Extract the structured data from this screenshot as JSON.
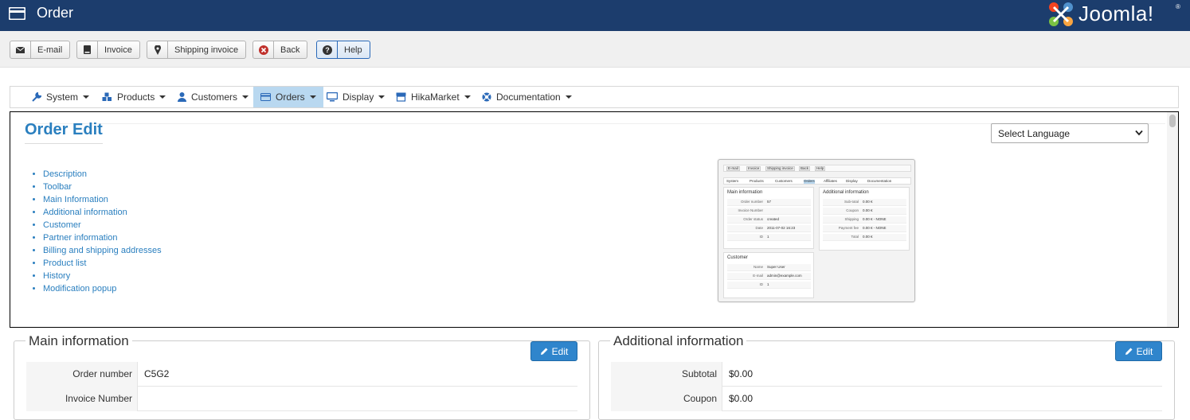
{
  "header": {
    "title": "Order",
    "title_icon": "credit-card-icon",
    "brand": "Joomla!",
    "brand_mark": "®"
  },
  "toolbar": {
    "buttons": [
      {
        "label": "E-mail",
        "icon": "envelope-icon"
      },
      {
        "label": "Invoice",
        "icon": "book-icon"
      },
      {
        "label": "Shipping invoice",
        "icon": "map-pin-icon"
      },
      {
        "label": "Back",
        "icon": "cancel-circle-icon"
      },
      {
        "label": "Help",
        "icon": "question-circle-icon"
      }
    ]
  },
  "menu": {
    "items": [
      {
        "label": "System",
        "icon": "wrench-icon"
      },
      {
        "label": "Products",
        "icon": "cubes-icon"
      },
      {
        "label": "Customers",
        "icon": "user-icon"
      },
      {
        "label": "Orders",
        "icon": "credit-card-icon",
        "active": true
      },
      {
        "label": "Display",
        "icon": "monitor-icon"
      },
      {
        "label": "HikaMarket",
        "icon": "shop-icon"
      },
      {
        "label": "Documentation",
        "icon": "lifebuoy-icon"
      }
    ]
  },
  "doc": {
    "title": "Order Edit",
    "language_select": "Select Language",
    "links": [
      "Description",
      "Toolbar",
      "Main Information",
      "Additional information",
      "Customer",
      "Partner information",
      "Billing and shipping addresses",
      "Product list",
      "History",
      "Modification popup"
    ],
    "thumbnail": {
      "toolbar": [
        "E-mail",
        "Invoice",
        "Shipping invoice",
        "Back",
        "Help"
      ],
      "menu": [
        "System",
        "Products",
        "Customers",
        "Orders",
        "Affiliates",
        "Display",
        "Documentation"
      ],
      "main_title": "Main information",
      "main_rows": [
        [
          "Order number",
          "57"
        ],
        [
          "Invoice Number",
          ""
        ],
        [
          "Order status",
          "created"
        ],
        [
          "Date",
          "2011-07-02 16:23"
        ],
        [
          "ID",
          "1"
        ]
      ],
      "additional_title": "Additional information",
      "additional_rows": [
        [
          "Sub-total",
          "0.00 €"
        ],
        [
          "Coupon",
          "0.00 €"
        ],
        [
          "Shipping",
          "0.00 € - NONE"
        ],
        [
          "Payment fee",
          "0.00 € - NONE"
        ],
        [
          "Total",
          "0.00 €"
        ]
      ],
      "customer_title": "Customer",
      "customer_rows": [
        [
          "Name",
          "Super User"
        ],
        [
          "E-mail",
          "admin@example.com"
        ],
        [
          "ID",
          "1"
        ]
      ]
    }
  },
  "main_info": {
    "legend": "Main information",
    "edit_label": "Edit",
    "rows": [
      {
        "key": "Order number",
        "value": "C5G2"
      },
      {
        "key": "Invoice Number",
        "value": ""
      }
    ]
  },
  "additional_info": {
    "legend": "Additional information",
    "edit_label": "Edit",
    "rows": [
      {
        "key": "Subtotal",
        "value": "$0.00"
      },
      {
        "key": "Coupon",
        "value": "$0.00"
      }
    ]
  },
  "colors": {
    "header_bg": "#1c3d6d",
    "accent": "#2a7fbf",
    "edit_btn": "#2f85cc",
    "menu_active": "#b9d8f0"
  }
}
